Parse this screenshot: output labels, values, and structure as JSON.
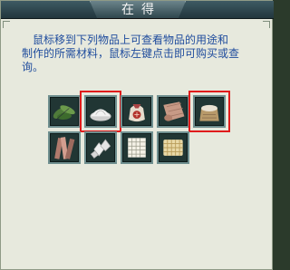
{
  "window": {
    "title": "在得"
  },
  "description": {
    "line1": "鼠标移到下列物品上可查看物品的用途和",
    "line2": "制作的所需材料，鼠标左键点击即可购买或查",
    "line3": "询。"
  },
  "items": [
    {
      "icon": "green-leaves-icon",
      "selected": false
    },
    {
      "icon": "white-powder-icon",
      "selected": true
    },
    {
      "icon": "red-sack-icon",
      "selected": false
    },
    {
      "icon": "leather-roll-icon",
      "selected": false
    },
    {
      "icon": "flour-sack-icon",
      "selected": true
    },
    {
      "icon": "cloth-strips-icon",
      "selected": false
    },
    {
      "icon": "white-crystals-icon",
      "selected": false
    },
    {
      "icon": "grid-paper-icon",
      "selected": false
    },
    {
      "icon": "woven-mat-icon",
      "selected": false
    }
  ],
  "colors": {
    "highlight": "#e01b1b",
    "text_blue": "#1f4c9d"
  }
}
